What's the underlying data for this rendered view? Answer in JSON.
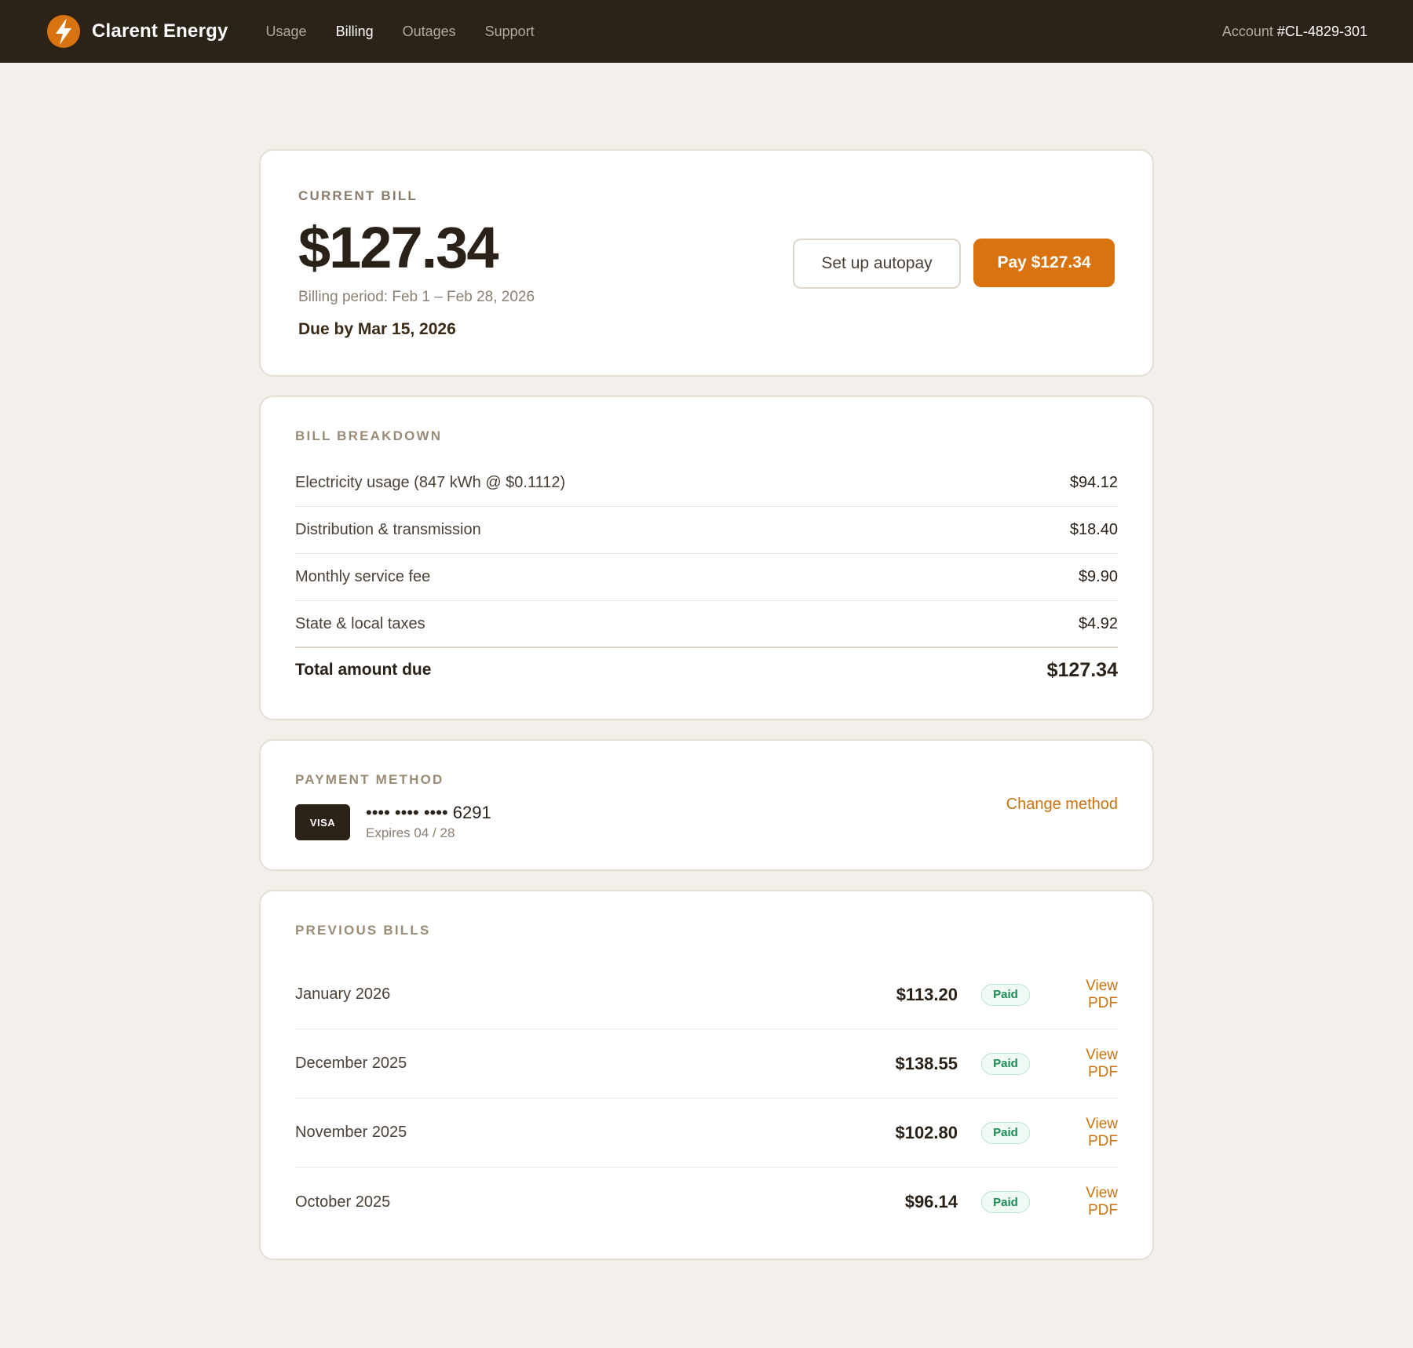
{
  "header": {
    "brand": "Clarent Energy",
    "nav": [
      "Usage",
      "Billing",
      "Outages",
      "Support"
    ],
    "active_nav": "Billing",
    "account_label": "Account",
    "account_number": "#CL-4829-301",
    "logo_icon": "lightning-bolt-icon",
    "logo_color": "#d9730f"
  },
  "current_bill": {
    "label": "CURRENT BILL",
    "amount": "$127.34",
    "period": "Billing period: Feb 1 – Feb 28, 2026",
    "due": "Due by Mar 15, 2026",
    "autopay_label": "Set up autopay",
    "pay_label": "Pay $127.34"
  },
  "breakdown": {
    "label": "BILL BREAKDOWN",
    "items": [
      {
        "label": "Electricity usage (847 kWh @ $0.1112)",
        "value": "$94.12"
      },
      {
        "label": "Distribution & transmission",
        "value": "$18.40"
      },
      {
        "label": "Monthly service fee",
        "value": "$9.90"
      },
      {
        "label": "State & local taxes",
        "value": "$4.92"
      }
    ],
    "total_label": "Total amount due",
    "total_value": "$127.34"
  },
  "payment": {
    "label": "PAYMENT METHOD",
    "brand": "VISA",
    "number": "•••• •••• •••• 6291",
    "expires": "Expires 04 / 28",
    "change_label": "Change method"
  },
  "previous": {
    "label": "PREVIOUS BILLS",
    "bills": [
      {
        "month": "January 2026",
        "amount": "$113.20",
        "status": "Paid",
        "action": "View PDF"
      },
      {
        "month": "December 2025",
        "amount": "$138.55",
        "status": "Paid",
        "action": "View PDF"
      },
      {
        "month": "November 2025",
        "amount": "$102.80",
        "status": "Paid",
        "action": "View PDF"
      },
      {
        "month": "October 2025",
        "amount": "$96.14",
        "status": "Paid",
        "action": "View PDF"
      }
    ]
  },
  "colors": {
    "accent": "#d9730f",
    "header_bg": "#2c2318",
    "page_bg": "#f3f0eb",
    "paid_green": "#1d8a56"
  }
}
